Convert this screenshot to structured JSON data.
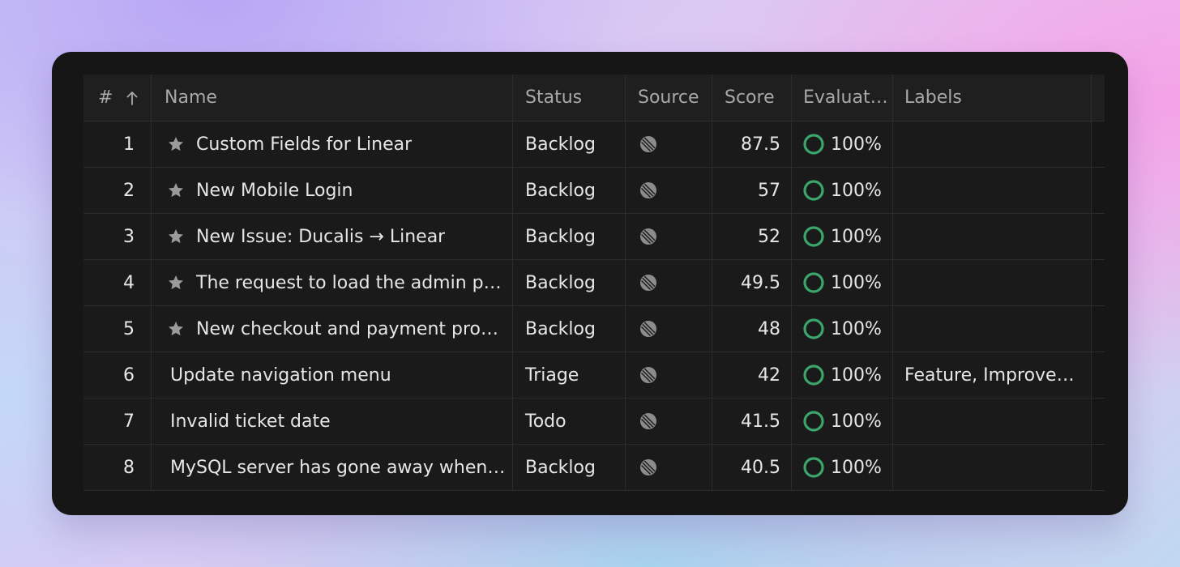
{
  "columns": {
    "num": "#",
    "name": "Name",
    "status": "Status",
    "source": "Source",
    "score": "Score",
    "evaluation": "Evaluat…",
    "labels": "Labels"
  },
  "colors": {
    "accent_ring": "#3ba56b",
    "text_primary": "#e6e6e6",
    "text_header": "#a8a8a8"
  },
  "rows": [
    {
      "num": "1",
      "starred": true,
      "name": "Custom Fields for Linear",
      "status": "Backlog",
      "source_icon": "linear-source-icon",
      "score": "87.5",
      "evaluation": "100%",
      "labels": ""
    },
    {
      "num": "2",
      "starred": true,
      "name": "New Mobile Login",
      "status": "Backlog",
      "source_icon": "linear-source-icon",
      "score": "57",
      "evaluation": "100%",
      "labels": ""
    },
    {
      "num": "3",
      "starred": true,
      "name": "New Issue: Ducalis → Linear",
      "status": "Backlog",
      "source_icon": "linear-source-icon",
      "score": "52",
      "evaluation": "100%",
      "labels": ""
    },
    {
      "num": "4",
      "starred": true,
      "name": "The request to load the admin p…",
      "status": "Backlog",
      "source_icon": "linear-source-icon",
      "score": "49.5",
      "evaluation": "100%",
      "labels": ""
    },
    {
      "num": "5",
      "starred": true,
      "name": "New checkout and payment pro…",
      "status": "Backlog",
      "source_icon": "linear-source-icon",
      "score": "48",
      "evaluation": "100%",
      "labels": ""
    },
    {
      "num": "6",
      "starred": false,
      "name": "Update navigation menu",
      "status": "Triage",
      "source_icon": "linear-source-icon",
      "score": "42",
      "evaluation": "100%",
      "labels": "Feature, Improvem…"
    },
    {
      "num": "7",
      "starred": false,
      "name": "Invalid ticket date",
      "status": "Todo",
      "source_icon": "linear-source-icon",
      "score": "41.5",
      "evaluation": "100%",
      "labels": ""
    },
    {
      "num": "8",
      "starred": false,
      "name": "MySQL server has gone away when…",
      "status": "Backlog",
      "source_icon": "linear-source-icon",
      "score": "40.5",
      "evaluation": "100%",
      "labels": ""
    }
  ]
}
